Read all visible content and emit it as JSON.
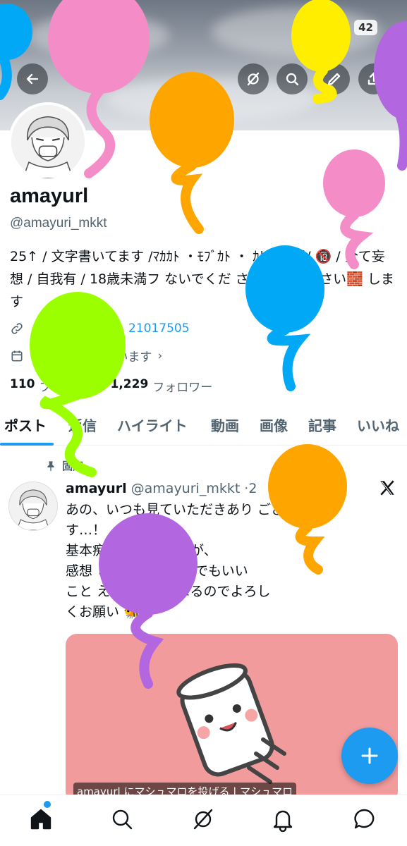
{
  "status": {
    "battery": "42"
  },
  "header_actions": [
    "back-icon",
    "grok-icon",
    "search-icon",
    "edit-icon",
    "share-icon"
  ],
  "profile": {
    "name": "amayurl",
    "handle": "@amayuri_mkkt",
    "bio": "25↑ / 文字書いてます /ﾏｶｶﾄ ・ﾓﾌﾞｶﾄ ・ ｶﾄ右全般/ 🔞 / 全て妄想 / 自我有 / 18歳未満フ ないでくだ さい。 てください🧱 します",
    "link": "21017505",
    "joined": "2 Xを利用しています",
    "following_count": "110",
    "following_label": "フォロー中",
    "followers_count": "1,229",
    "followers_label": "フォロワー"
  },
  "tabs": [
    "ポスト",
    "返信",
    "ハイライト",
    "動画",
    "画像",
    "記事",
    "いいね"
  ],
  "post": {
    "pinned_label": "固定",
    "name": "amayurl",
    "handle": "@amayuri_mkkt",
    "time": "·2",
    "text": "あの、いつも見ていただきあり ございま\nす…！\n基本痴 ているのですが、\n感想 とか質問とかと でもいい\nこと えると元気になるのでよろし\nくお願い 🐝",
    "card_caption": "amayurl にマシュマロを投げる | マシュマロ"
  },
  "fab": {
    "label": "+"
  },
  "bottom_nav": [
    "home-icon",
    "search-icon",
    "grok-icon",
    "notifications-icon",
    "messages-icon"
  ],
  "colors": {
    "accent": "#1d9bf0",
    "card_bg": "#f29b9c",
    "doodle_pink": "#f48cc8",
    "doodle_orange": "#ffa500",
    "doodle_yellow": "#ffee00",
    "doodle_blue": "#00a8f5",
    "doodle_green": "#9cff00",
    "doodle_purple": "#b266e0"
  }
}
